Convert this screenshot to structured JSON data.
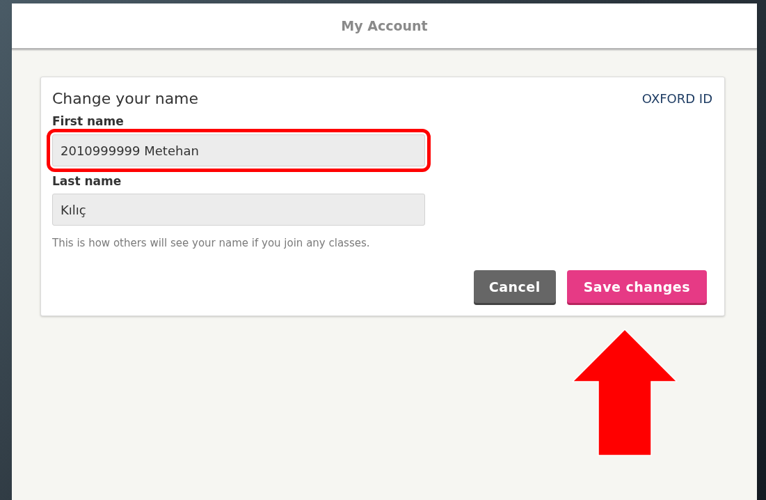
{
  "header": {
    "title": "My Account"
  },
  "card": {
    "title": "Change your name",
    "badge": "OXFORD ID",
    "fields": [
      {
        "label": "First name",
        "value": "2010999999 Metehan",
        "highlighted": true
      },
      {
        "label": "Last name",
        "value": "Kılıç",
        "highlighted": false
      }
    ],
    "hint": "This is how others will see your name if you join any classes.",
    "buttons": [
      {
        "label": "Cancel",
        "kind": "secondary"
      },
      {
        "label": "Save changes",
        "kind": "primary"
      }
    ]
  }
}
